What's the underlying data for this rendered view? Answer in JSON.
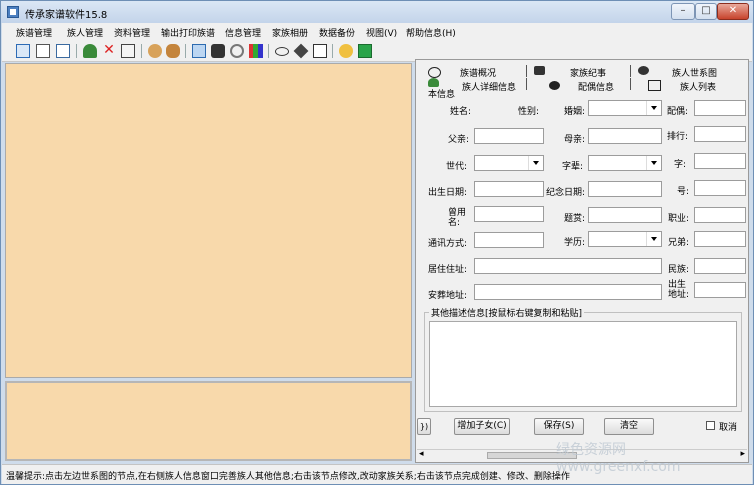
{
  "window": {
    "title": "传承家谱软件15.8",
    "buttons": {
      "minimize": "–",
      "maximize": "□",
      "close": "✕"
    }
  },
  "menu": [
    "族谱管理",
    "族人管理",
    "资料管理",
    "输出打印族谱",
    "信息管理",
    "家族相册",
    "数据备份",
    "视图(V)",
    "帮助信息(H)"
  ],
  "toolbar_icons": [
    "settings-icon",
    "book-icon",
    "frame-icon",
    "person-icon",
    "delete-icon",
    "document-icon",
    "people-icon",
    "group-icon",
    "tree-icon",
    "binoculars-icon",
    "gear-icon",
    "bar-chart-icon",
    "eye-icon",
    "tag-icon",
    "text-box-icon",
    "camera-icon",
    "exit-icon"
  ],
  "tabs_row1": [
    "族谱概况",
    "家族纪事",
    "族人世系图"
  ],
  "tabs_row2": [
    "族人详细信息",
    "配偶信息",
    "族人列表"
  ],
  "tab_cut_label": "本信息",
  "form": {
    "name": "姓名:",
    "gender": "性别:",
    "marriage": "婚姻:",
    "spouse": "配偶:",
    "father": "父亲:",
    "mother": "母亲:",
    "rank": "排行:",
    "generation": "世代:",
    "zibei": "字辈:",
    "zi": "字:",
    "birth_date": "出生日期:",
    "memorial_date": "纪念日期:",
    "hao": "号:",
    "former_name": "曾用名:",
    "honor": "题赏:",
    "occupation": "职业:",
    "contact": "通讯方式:",
    "education": "学历:",
    "siblings": "兄弟:",
    "residence": "居住住址:",
    "ethnicity": "民族:",
    "burial": "安葬地址:",
    "birthplace": "出生地址:"
  },
  "other_info_title": "其他描述信息[按鼠标右键复制和粘贴]",
  "buttons": {
    "add_child": "增加子女(C)",
    "save": "保存(S)",
    "clear": "清空",
    "cancel": "取消"
  },
  "status": "温馨提示:点击左边世系图的节点,在右侧族人信息窗口完善族人其他信息;右击该节点修改,改动家族关系;右击该节点完成创建、修改、删除操作",
  "watermark": "绿色资源网 www.greenxf.com"
}
